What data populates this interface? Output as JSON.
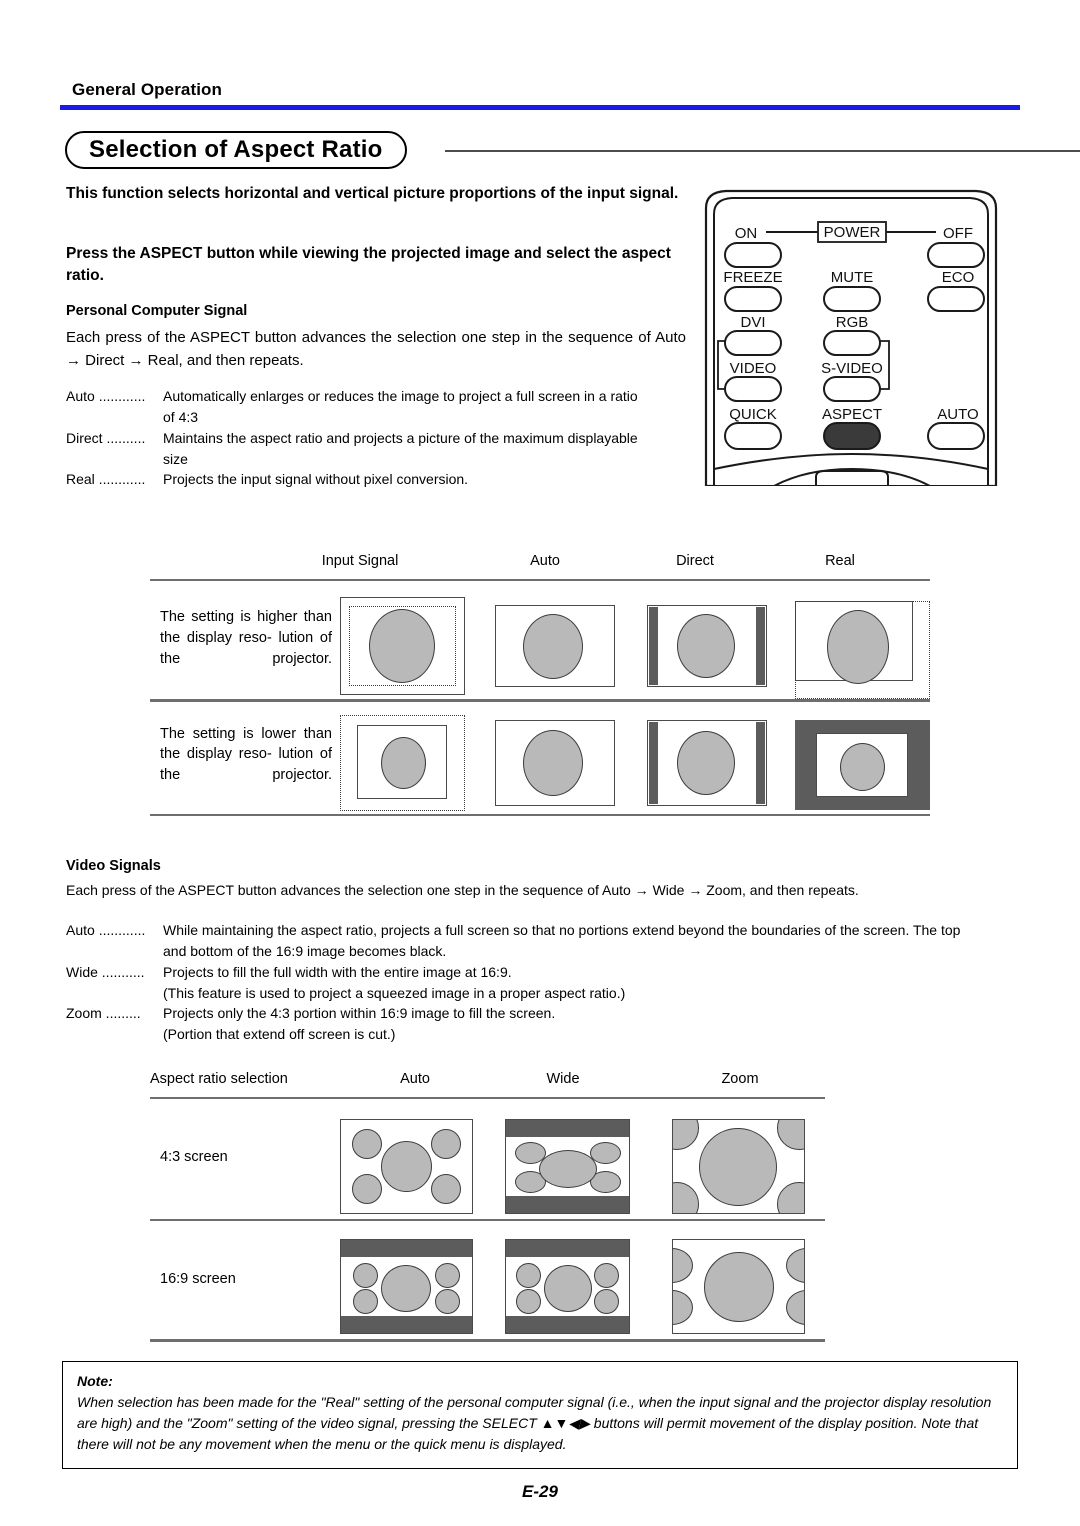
{
  "header": {
    "section": "General Operation",
    "rule_color": "#1a1ae6"
  },
  "title": "Selection of Aspect Ratio",
  "intro": "This function selects horizontal and vertical picture proportions of the input signal.",
  "press_instruction": "Press the ASPECT button while viewing the projected image and select the aspect ratio.",
  "pc_section": {
    "heading": "Personal Computer Signal",
    "body": "Each press of the ASPECT button advances the selection one step in the sequence of Auto → Direct → Real, and then repeats.",
    "definitions": [
      {
        "term": "Auto ............",
        "desc": "Automatically enlarges or reduces the image to project a full screen in a ratio",
        "cont": "of 4:3"
      },
      {
        "term": "Direct ..........",
        "desc": "Maintains the aspect ratio and projects a picture of the maximum displayable",
        "cont": "size"
      },
      {
        "term": "Real ............",
        "desc": "Projects the input signal without pixel conversion.",
        "cont": ""
      }
    ]
  },
  "remote": {
    "power_label": "POWER",
    "on": "ON",
    "off": "OFF",
    "freeze": "FREEZE",
    "mute": "MUTE",
    "eco": "ECO",
    "dvi": "DVI",
    "rgb": "RGB",
    "video": "VIDEO",
    "svideo": "S-VIDEO",
    "quick": "QUICK",
    "aspect": "ASPECT",
    "auto": "AUTO",
    "highlight_color": "#3a3a3a"
  },
  "table_pc": {
    "headers": [
      "Input Signal",
      "Auto",
      "Direct",
      "Real"
    ],
    "rows": [
      {
        "label": "The setting is higher than the display reso- lution of the projector."
      },
      {
        "label": "The setting is lower than the display reso- lution of the projector."
      }
    ]
  },
  "video_section": {
    "heading": "Video Signals",
    "body": "Each press of the ASPECT button advances the selection one step in the sequence of Auto → Wide → Zoom, and then repeats.",
    "definitions": [
      {
        "term": "Auto ............",
        "desc": "While maintaining the aspect ratio, projects a full screen so that no portions extend beyond the boundaries of the screen. The top",
        "cont": "and bottom of the 16:9 image becomes black."
      },
      {
        "term": "Wide ...........",
        "desc": "Projects to fill the full width with the entire image at 16:9.",
        "cont": "(This feature is used to project a squeezed image in a proper aspect ratio.)"
      },
      {
        "term": "Zoom .........",
        "desc": "Projects only the 4:3 portion within 16:9 image to fill the screen.",
        "cont": "(Portion that extend off screen is cut.)"
      }
    ]
  },
  "table_video": {
    "headers": [
      "Aspect ratio selection",
      "Auto",
      "Wide",
      "Zoom"
    ],
    "rows": [
      {
        "label": "4:3 screen"
      },
      {
        "label": "16:9 screen"
      }
    ]
  },
  "note": {
    "label": "Note:",
    "text": "When selection has been made for the \"Real\" setting of the personal computer signal (i.e., when the input signal and the projector display resolution are high) and the \"Zoom\" setting of the video signal, pressing the SELECT ▲▼◀▶ buttons will permit movement of the display position. Note that there will not be any movement when the menu or the quick menu is displayed."
  },
  "page_number": "E-29"
}
